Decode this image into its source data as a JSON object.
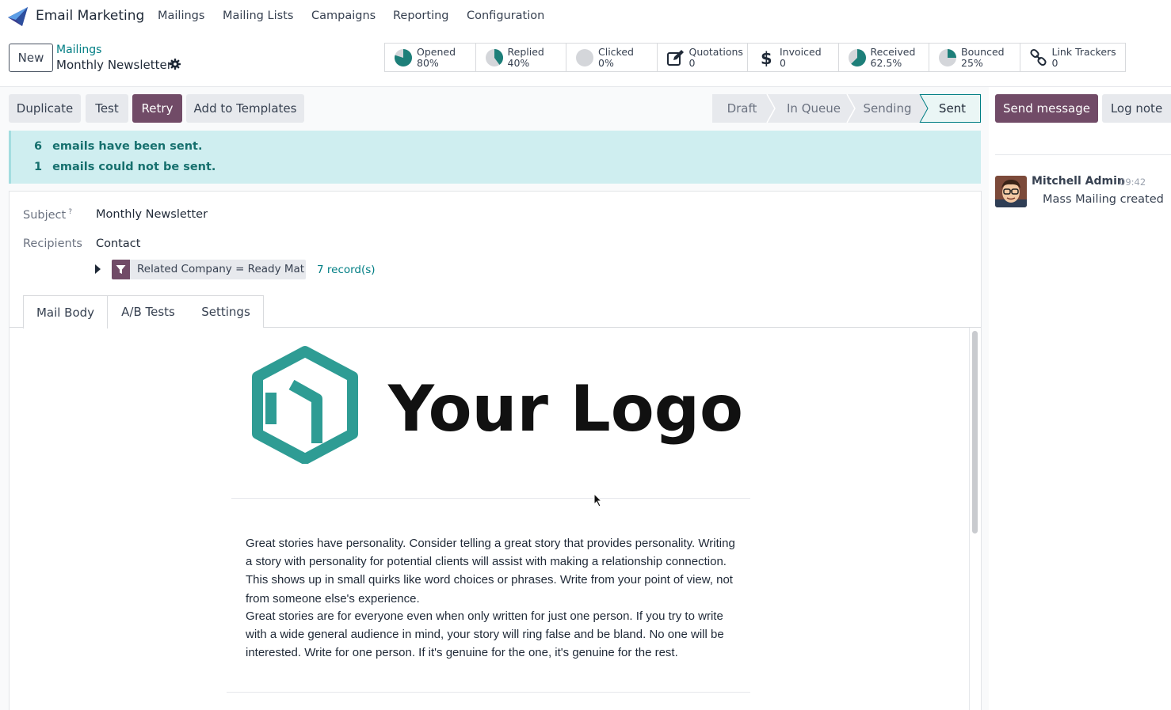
{
  "navbar": {
    "app_name": "Email Marketing",
    "menu": [
      "Mailings",
      "Mailing Lists",
      "Campaigns",
      "Reporting",
      "Configuration"
    ]
  },
  "control": {
    "new_label": "New",
    "breadcrumb_parent": "Mailings",
    "breadcrumb_current": "Monthly Newsletter"
  },
  "stats": [
    {
      "label": "Opened",
      "value": "80%",
      "icon": "pie-icon",
      "fraction": 0.8
    },
    {
      "label": "Replied",
      "value": "40%",
      "icon": "pie-icon",
      "fraction": 0.4
    },
    {
      "label": "Clicked",
      "value": "0%",
      "icon": "pie-icon",
      "fraction": 0
    },
    {
      "label": "Quotations",
      "value": "0",
      "icon": "edit-icon"
    },
    {
      "label": "Invoiced",
      "value": "0",
      "icon": "dollar-icon"
    },
    {
      "label": "Received",
      "value": "62.5%",
      "icon": "pie-icon",
      "fraction": 0.625
    },
    {
      "label": "Bounced",
      "value": "25%",
      "icon": "pie-icon",
      "fraction": 0.25
    },
    {
      "label": "Link Trackers",
      "value": "0",
      "icon": "link-icon"
    }
  ],
  "actions": {
    "duplicate": "Duplicate",
    "test": "Test",
    "retry": "Retry",
    "add_templates": "Add to Templates"
  },
  "status": {
    "stages": [
      "Draft",
      "In Queue",
      "Sending",
      "Sent"
    ],
    "current": "Sent"
  },
  "chatter_buttons": {
    "send_message": "Send message",
    "log_note": "Log note"
  },
  "alert": {
    "sent_count": "6",
    "sent_text": "emails have been sent.",
    "failed_count": "1",
    "failed_text": "emails could not be sent."
  },
  "form": {
    "subject_label": "Subject",
    "subject_help": "?",
    "subject_value": "Monthly Newsletter",
    "recipients_label": "Recipients",
    "recipients_value": "Contact",
    "filter_text": "Related Company = Ready Mat",
    "records_text": "7 record(s)"
  },
  "tabs": [
    "Mail Body",
    "A/B Tests",
    "Settings"
  ],
  "mail_body": {
    "logo_text": "Your Logo",
    "paragraph1": "Great stories have personality. Consider telling a great story that provides personality. Writing a story with personality for potential clients will assist with making a relationship connection. This shows up in small quirks like word choices or phrases. Write from your point of view, not from someone else's experience.",
    "paragraph2": "Great stories are for everyone even when only written for just one person. If you try to write with a wide general audience in mind, your story will ring false and be bland. No one will be interested. Write for one person. If it's genuine for the one, it's genuine for the rest."
  },
  "chatter": {
    "author": "Mitchell Admin",
    "time": "09:42",
    "message": "Mass Mailing created"
  },
  "colors": {
    "primary": "#714b67",
    "teal": "#017e84",
    "alert_bg": "#cfeef0",
    "alert_text": "#16706e",
    "logo_teal": "#2e9c94"
  }
}
